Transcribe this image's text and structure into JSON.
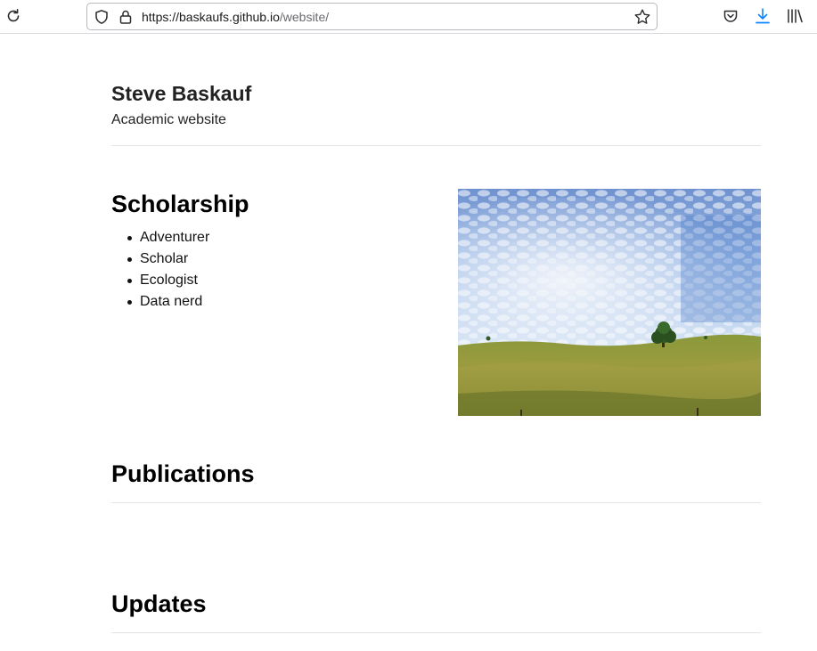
{
  "browser": {
    "url_host": "https://baskaufs.github.io",
    "url_path": "/website/",
    "icons": {
      "reload": "reload-icon",
      "shield": "tracking-shield-icon",
      "lock": "lock-icon",
      "bookmark": "star-icon",
      "pocket": "pocket-icon",
      "download": "download-icon",
      "library": "library-icon"
    },
    "accent": "#0a84ff"
  },
  "header": {
    "title": "Steve Baskauf",
    "subtitle": "Academic website"
  },
  "scholarship": {
    "heading": "Scholarship",
    "items": [
      "Adventurer",
      "Scholar",
      "Ecologist",
      "Data nerd"
    ],
    "image": "landscape-photo"
  },
  "publications": {
    "heading": "Publications"
  },
  "updates": {
    "heading": "Updates"
  }
}
